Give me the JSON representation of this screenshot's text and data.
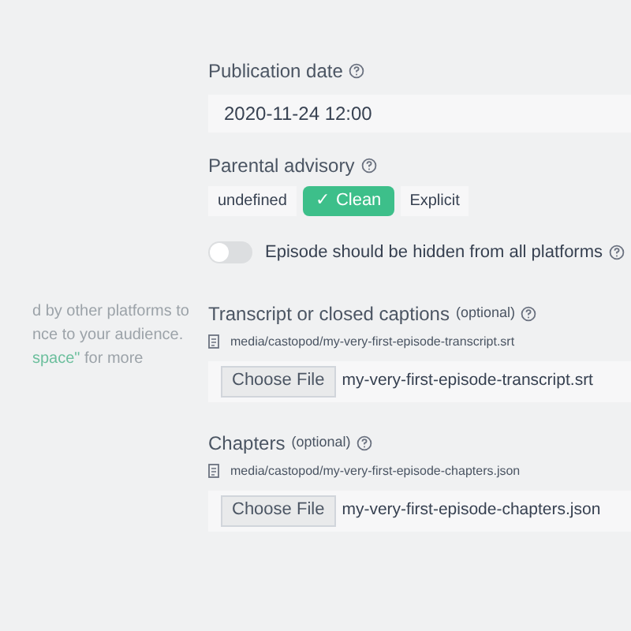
{
  "sidebar_help": {
    "lines": [
      "d by other platforms to",
      "nce to your audience."
    ],
    "link": "space\"",
    "after_link": " for more"
  },
  "publication_date": {
    "label": "Publication date",
    "value": "2020-11-24 12:00"
  },
  "parental_advisory": {
    "label": "Parental advisory",
    "options": [
      {
        "label": "undefined",
        "selected": false
      },
      {
        "label": "Clean",
        "selected": true,
        "check": "✓"
      },
      {
        "label": "Explicit",
        "selected": false
      }
    ]
  },
  "hidden_toggle": {
    "label": "Episode should be hidden from all platforms",
    "on": false
  },
  "files": [
    {
      "label": "Transcript or closed captions",
      "optional": "(optional)",
      "path": "media/castopod/my-very-first-episode-transcript.srt",
      "button": "Choose File",
      "file_name": "my-very-first-episode-transcript.srt"
    },
    {
      "label": "Chapters",
      "optional": "(optional)",
      "path": "media/castopod/my-very-first-episode-chapters.json",
      "button": "Choose File",
      "file_name": "my-very-first-episode-chapters.json"
    }
  ]
}
